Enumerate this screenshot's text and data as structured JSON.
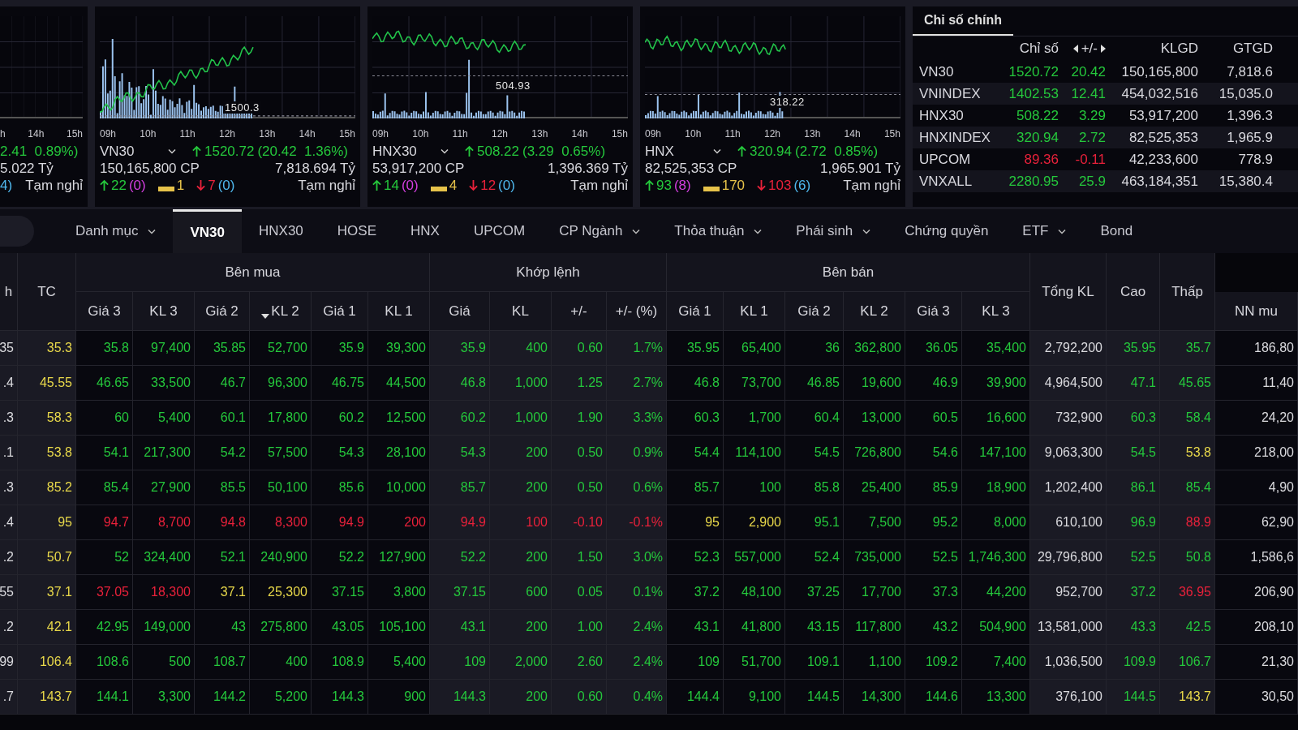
{
  "index_panels": [
    {
      "ticks": [
        "h",
        "14h",
        "15h"
      ],
      "change": "2.41  0.89%)",
      "color": "#25c83c",
      "trading_value": "5.022 Tỷ",
      "floor": "4)",
      "session": "Tạm nghỉ"
    },
    {
      "ticks": [
        "09h",
        "10h",
        "11h",
        "12h",
        "13h",
        "14h",
        "15h"
      ],
      "reference_label": "1500.3",
      "name": "VN30",
      "rising": true,
      "color": "#25c83c",
      "value": "1520.72",
      "change": "(20.42  1.36%)",
      "volume": "150,165,800 CP",
      "trading_value": "7,818.694 Tỷ",
      "up": "22",
      "ceiling": "(0)",
      "ref": "1",
      "down": "7",
      "floor": "(0)",
      "session": "Tạm nghỉ"
    },
    {
      "ticks": [
        "09h",
        "10h",
        "11h",
        "12h",
        "13h",
        "14h",
        "15h"
      ],
      "reference_label": "504.93",
      "name": "HNX30",
      "rising": true,
      "color": "#25c83c",
      "value": "508.22",
      "change": "(3.29  0.65%)",
      "volume": "53,917,200 CP",
      "trading_value": "1,396.369 Tỷ",
      "up": "14",
      "ceiling": "(0)",
      "ref": "4",
      "down": "12",
      "floor": "(0)",
      "session": "Tạm nghỉ"
    },
    {
      "ticks": [
        "09h",
        "10h",
        "11h",
        "12h",
        "13h",
        "14h",
        "15h"
      ],
      "reference_label": "318.22",
      "name": "HNX",
      "rising": true,
      "color": "#25c83c",
      "value": "320.94",
      "change": "(2.72  0.85%)",
      "volume": "82,525,353 CP",
      "trading_value": "1,965.901 Tỷ",
      "up": "93",
      "ceiling": "(8)",
      "ref": "170",
      "down": "103",
      "floor": "(6)",
      "session": "Tạm nghỉ"
    }
  ],
  "main_indices": {
    "tab": {
      "label": "Chỉ số chính",
      "selected": true
    },
    "columns": [
      {
        "label": "Chỉ số",
        "switchable": false
      },
      {
        "label": "+/-",
        "switchable": true
      },
      {
        "label": "KLGD",
        "switchable": false
      },
      {
        "label": "GTGD",
        "switchable": false
      }
    ],
    "rows": [
      {
        "name": "VN30",
        "value": "1520.72",
        "change": "20.42",
        "volume": "150,165,800",
        "trading_value": "7,818.6",
        "color": "#25c83c"
      },
      {
        "name": "VNINDEX",
        "value": "1402.53",
        "change": "12.41",
        "volume": "454,032,516",
        "trading_value": "15,035.0",
        "color": "#25c83c"
      },
      {
        "name": "HNX30",
        "value": "508.22",
        "change": "3.29",
        "volume": "53,917,200",
        "trading_value": "1,396.3",
        "color": "#25c83c"
      },
      {
        "name": "HNXINDEX",
        "value": "320.94",
        "change": "2.72",
        "volume": "82,525,353",
        "trading_value": "1,965.9",
        "color": "#25c83c"
      },
      {
        "name": "UPCOM",
        "value": "89.36",
        "change": "-0.11",
        "volume": "42,233,600",
        "trading_value": "778.9",
        "color": "#e8213a"
      },
      {
        "name": "VNXALL",
        "value": "2280.95",
        "change": "25.9",
        "volume": "463,184,351",
        "trading_value": "15,380.4",
        "color": "#25c83c"
      }
    ]
  },
  "tabs": [
    {
      "label": "Danh mục",
      "dropdown": true,
      "selected": false
    },
    {
      "label": "VN30",
      "dropdown": false,
      "selected": true
    },
    {
      "label": "HNX30",
      "dropdown": false,
      "selected": false
    },
    {
      "label": "HOSE",
      "dropdown": false,
      "selected": false
    },
    {
      "label": "HNX",
      "dropdown": false,
      "selected": false
    },
    {
      "label": "UPCOM",
      "dropdown": false,
      "selected": false
    },
    {
      "label": "CP Ngành",
      "dropdown": true,
      "selected": false
    },
    {
      "label": "Thỏa thuận",
      "dropdown": true,
      "selected": false
    },
    {
      "label": "Phái sinh",
      "dropdown": true,
      "selected": false
    },
    {
      "label": "Chứng quyền",
      "dropdown": false,
      "selected": false
    },
    {
      "label": "ETF",
      "dropdown": true,
      "selected": false
    },
    {
      "label": "Bond",
      "dropdown": false,
      "selected": false
    }
  ],
  "table": {
    "header": [
      {
        "label": "h"
      },
      {
        "label": "TC"
      },
      {
        "label": "Bên mua",
        "columns": [
          {
            "label": "Giá 3",
            "sorted": false
          },
          {
            "label": "KL 3",
            "sorted": false
          },
          {
            "label": "Giá 2",
            "sorted": false
          },
          {
            "label": "KL 2",
            "sorted": true
          },
          {
            "label": "Giá 1",
            "sorted": false
          },
          {
            "label": "KL 1",
            "sorted": false
          }
        ]
      },
      {
        "label": "Khớp lệnh",
        "columns": [
          {
            "label": "Giá",
            "sorted": false
          },
          {
            "label": "KL",
            "sorted": false
          },
          {
            "label": "+/-",
            "sorted": false
          },
          {
            "label": "+/- (%)",
            "sorted": false
          }
        ]
      },
      {
        "label": "Bên bán",
        "columns": [
          {
            "label": "Giá 1",
            "sorted": false
          },
          {
            "label": "KL 1",
            "sorted": false
          },
          {
            "label": "Giá 2",
            "sorted": false
          },
          {
            "label": "KL 2",
            "sorted": false
          },
          {
            "label": "Giá 3",
            "sorted": false
          },
          {
            "label": "KL 3",
            "sorted": false
          }
        ]
      },
      {
        "label": "Tổng KL"
      },
      {
        "label": "Cao"
      },
      {
        "label": "Thấp"
      },
      {
        "columns": [
          {
            "label": "NN mu",
            "sorted": false
          }
        ]
      }
    ],
    "rows": [
      {
        "cells": [
          {
            "text": "35",
            "color": "#dadade"
          },
          {
            "text": "35.3",
            "color": "#e8d84a"
          },
          {
            "text": "35.8",
            "color": "#25c83c"
          },
          {
            "text": "97,400",
            "color": "#25c83c"
          },
          {
            "text": "35.85",
            "color": "#25c83c"
          },
          {
            "text": "52,700",
            "color": "#25c83c"
          },
          {
            "text": "35.9",
            "color": "#25c83c"
          },
          {
            "text": "39,300",
            "color": "#25c83c"
          },
          {
            "text": "35.9",
            "color": "#25c83c"
          },
          {
            "text": "400",
            "color": "#25c83c"
          },
          {
            "text": "0.60",
            "color": "#25c83c"
          },
          {
            "text": "1.7%",
            "color": "#25c83c"
          },
          {
            "text": "35.95",
            "color": "#25c83c"
          },
          {
            "text": "65,400",
            "color": "#25c83c"
          },
          {
            "text": "36",
            "color": "#25c83c"
          },
          {
            "text": "362,800",
            "color": "#25c83c"
          },
          {
            "text": "36.05",
            "color": "#25c83c"
          },
          {
            "text": "35,400",
            "color": "#25c83c"
          },
          {
            "text": "2,792,200",
            "color": "#dadade"
          },
          {
            "text": "35.95",
            "color": "#25c83c"
          },
          {
            "text": "35.7",
            "color": "#25c83c"
          },
          {
            "text": "186,80",
            "color": "#dadade"
          }
        ]
      },
      {
        "cells": [
          {
            "text": ".4",
            "color": "#dadade"
          },
          {
            "text": "45.55",
            "color": "#e8d84a"
          },
          {
            "text": "46.65",
            "color": "#25c83c"
          },
          {
            "text": "33,500",
            "color": "#25c83c"
          },
          {
            "text": "46.7",
            "color": "#25c83c"
          },
          {
            "text": "96,300",
            "color": "#25c83c"
          },
          {
            "text": "46.75",
            "color": "#25c83c"
          },
          {
            "text": "44,500",
            "color": "#25c83c"
          },
          {
            "text": "46.8",
            "color": "#25c83c"
          },
          {
            "text": "1,000",
            "color": "#25c83c"
          },
          {
            "text": "1.25",
            "color": "#25c83c"
          },
          {
            "text": "2.7%",
            "color": "#25c83c"
          },
          {
            "text": "46.8",
            "color": "#25c83c"
          },
          {
            "text": "73,700",
            "color": "#25c83c"
          },
          {
            "text": "46.85",
            "color": "#25c83c"
          },
          {
            "text": "19,600",
            "color": "#25c83c"
          },
          {
            "text": "46.9",
            "color": "#25c83c"
          },
          {
            "text": "39,900",
            "color": "#25c83c"
          },
          {
            "text": "4,964,500",
            "color": "#dadade"
          },
          {
            "text": "47.1",
            "color": "#25c83c"
          },
          {
            "text": "45.65",
            "color": "#25c83c"
          },
          {
            "text": "11,40",
            "color": "#dadade"
          }
        ]
      },
      {
        "cells": [
          {
            "text": ".3",
            "color": "#dadade"
          },
          {
            "text": "58.3",
            "color": "#e8d84a"
          },
          {
            "text": "60",
            "color": "#25c83c"
          },
          {
            "text": "5,400",
            "color": "#25c83c"
          },
          {
            "text": "60.1",
            "color": "#25c83c"
          },
          {
            "text": "17,800",
            "color": "#25c83c"
          },
          {
            "text": "60.2",
            "color": "#25c83c"
          },
          {
            "text": "12,500",
            "color": "#25c83c"
          },
          {
            "text": "60.2",
            "color": "#25c83c"
          },
          {
            "text": "1,000",
            "color": "#25c83c"
          },
          {
            "text": "1.90",
            "color": "#25c83c"
          },
          {
            "text": "3.3%",
            "color": "#25c83c"
          },
          {
            "text": "60.3",
            "color": "#25c83c"
          },
          {
            "text": "1,700",
            "color": "#25c83c"
          },
          {
            "text": "60.4",
            "color": "#25c83c"
          },
          {
            "text": "13,000",
            "color": "#25c83c"
          },
          {
            "text": "60.5",
            "color": "#25c83c"
          },
          {
            "text": "16,600",
            "color": "#25c83c"
          },
          {
            "text": "732,900",
            "color": "#dadade"
          },
          {
            "text": "60.3",
            "color": "#25c83c"
          },
          {
            "text": "58.4",
            "color": "#25c83c"
          },
          {
            "text": "24,20",
            "color": "#dadade"
          }
        ]
      },
      {
        "cells": [
          {
            "text": ".1",
            "color": "#dadade"
          },
          {
            "text": "53.8",
            "color": "#e8d84a"
          },
          {
            "text": "54.1",
            "color": "#25c83c"
          },
          {
            "text": "217,300",
            "color": "#25c83c"
          },
          {
            "text": "54.2",
            "color": "#25c83c"
          },
          {
            "text": "57,500",
            "color": "#25c83c"
          },
          {
            "text": "54.3",
            "color": "#25c83c"
          },
          {
            "text": "28,100",
            "color": "#25c83c"
          },
          {
            "text": "54.3",
            "color": "#25c83c"
          },
          {
            "text": "200",
            "color": "#25c83c"
          },
          {
            "text": "0.50",
            "color": "#25c83c"
          },
          {
            "text": "0.9%",
            "color": "#25c83c"
          },
          {
            "text": "54.4",
            "color": "#25c83c"
          },
          {
            "text": "114,100",
            "color": "#25c83c"
          },
          {
            "text": "54.5",
            "color": "#25c83c"
          },
          {
            "text": "726,800",
            "color": "#25c83c"
          },
          {
            "text": "54.6",
            "color": "#25c83c"
          },
          {
            "text": "147,100",
            "color": "#25c83c"
          },
          {
            "text": "9,063,300",
            "color": "#dadade"
          },
          {
            "text": "54.5",
            "color": "#25c83c"
          },
          {
            "text": "53.8",
            "color": "#e8d84a"
          },
          {
            "text": "218,00",
            "color": "#dadade"
          }
        ]
      },
      {
        "cells": [
          {
            "text": ".3",
            "color": "#dadade"
          },
          {
            "text": "85.2",
            "color": "#e8d84a"
          },
          {
            "text": "85.4",
            "color": "#25c83c"
          },
          {
            "text": "27,900",
            "color": "#25c83c"
          },
          {
            "text": "85.5",
            "color": "#25c83c"
          },
          {
            "text": "50,100",
            "color": "#25c83c"
          },
          {
            "text": "85.6",
            "color": "#25c83c"
          },
          {
            "text": "10,000",
            "color": "#25c83c"
          },
          {
            "text": "85.7",
            "color": "#25c83c"
          },
          {
            "text": "200",
            "color": "#25c83c"
          },
          {
            "text": "0.50",
            "color": "#25c83c"
          },
          {
            "text": "0.6%",
            "color": "#25c83c"
          },
          {
            "text": "85.7",
            "color": "#25c83c"
          },
          {
            "text": "100",
            "color": "#25c83c"
          },
          {
            "text": "85.8",
            "color": "#25c83c"
          },
          {
            "text": "25,400",
            "color": "#25c83c"
          },
          {
            "text": "85.9",
            "color": "#25c83c"
          },
          {
            "text": "18,900",
            "color": "#25c83c"
          },
          {
            "text": "1,202,400",
            "color": "#dadade"
          },
          {
            "text": "86.1",
            "color": "#25c83c"
          },
          {
            "text": "85.4",
            "color": "#25c83c"
          },
          {
            "text": "4,90",
            "color": "#dadade"
          }
        ]
      },
      {
        "cells": [
          {
            "text": ".4",
            "color": "#dadade"
          },
          {
            "text": "95",
            "color": "#e8d84a"
          },
          {
            "text": "94.7",
            "color": "#e8213a"
          },
          {
            "text": "8,700",
            "color": "#e8213a"
          },
          {
            "text": "94.8",
            "color": "#e8213a"
          },
          {
            "text": "8,300",
            "color": "#e8213a"
          },
          {
            "text": "94.9",
            "color": "#e8213a"
          },
          {
            "text": "200",
            "color": "#e8213a"
          },
          {
            "text": "94.9",
            "color": "#e8213a"
          },
          {
            "text": "100",
            "color": "#e8213a"
          },
          {
            "text": "-0.10",
            "color": "#e8213a"
          },
          {
            "text": "-0.1%",
            "color": "#e8213a"
          },
          {
            "text": "95",
            "color": "#e8d84a"
          },
          {
            "text": "2,900",
            "color": "#e8d84a"
          },
          {
            "text": "95.1",
            "color": "#25c83c"
          },
          {
            "text": "7,500",
            "color": "#25c83c"
          },
          {
            "text": "95.2",
            "color": "#25c83c"
          },
          {
            "text": "8,000",
            "color": "#25c83c"
          },
          {
            "text": "610,100",
            "color": "#dadade"
          },
          {
            "text": "96.9",
            "color": "#25c83c"
          },
          {
            "text": "88.9",
            "color": "#e8213a"
          },
          {
            "text": "62,90",
            "color": "#dadade"
          }
        ]
      },
      {
        "cells": [
          {
            "text": ".2",
            "color": "#dadade"
          },
          {
            "text": "50.7",
            "color": "#e8d84a"
          },
          {
            "text": "52",
            "color": "#25c83c"
          },
          {
            "text": "324,400",
            "color": "#25c83c"
          },
          {
            "text": "52.1",
            "color": "#25c83c"
          },
          {
            "text": "240,900",
            "color": "#25c83c"
          },
          {
            "text": "52.2",
            "color": "#25c83c"
          },
          {
            "text": "127,900",
            "color": "#25c83c"
          },
          {
            "text": "52.2",
            "color": "#25c83c"
          },
          {
            "text": "200",
            "color": "#25c83c"
          },
          {
            "text": "1.50",
            "color": "#25c83c"
          },
          {
            "text": "3.0%",
            "color": "#25c83c"
          },
          {
            "text": "52.3",
            "color": "#25c83c"
          },
          {
            "text": "557,000",
            "color": "#25c83c"
          },
          {
            "text": "52.4",
            "color": "#25c83c"
          },
          {
            "text": "735,000",
            "color": "#25c83c"
          },
          {
            "text": "52.5",
            "color": "#25c83c"
          },
          {
            "text": "1,746,300",
            "color": "#25c83c"
          },
          {
            "text": "29,796,800",
            "color": "#dadade"
          },
          {
            "text": "52.5",
            "color": "#25c83c"
          },
          {
            "text": "50.8",
            "color": "#25c83c"
          },
          {
            "text": "1,586,6",
            "color": "#dadade"
          }
        ]
      },
      {
        "cells": [
          {
            "text": "55",
            "color": "#dadade"
          },
          {
            "text": "37.1",
            "color": "#e8d84a"
          },
          {
            "text": "37.05",
            "color": "#e8213a"
          },
          {
            "text": "18,300",
            "color": "#e8213a"
          },
          {
            "text": "37.1",
            "color": "#e8d84a"
          },
          {
            "text": "25,300",
            "color": "#e8d84a"
          },
          {
            "text": "37.15",
            "color": "#25c83c"
          },
          {
            "text": "3,800",
            "color": "#25c83c"
          },
          {
            "text": "37.15",
            "color": "#25c83c"
          },
          {
            "text": "600",
            "color": "#25c83c"
          },
          {
            "text": "0.05",
            "color": "#25c83c"
          },
          {
            "text": "0.1%",
            "color": "#25c83c"
          },
          {
            "text": "37.2",
            "color": "#25c83c"
          },
          {
            "text": "48,100",
            "color": "#25c83c"
          },
          {
            "text": "37.25",
            "color": "#25c83c"
          },
          {
            "text": "17,700",
            "color": "#25c83c"
          },
          {
            "text": "37.3",
            "color": "#25c83c"
          },
          {
            "text": "44,200",
            "color": "#25c83c"
          },
          {
            "text": "952,700",
            "color": "#dadade"
          },
          {
            "text": "37.2",
            "color": "#25c83c"
          },
          {
            "text": "36.95",
            "color": "#e8213a"
          },
          {
            "text": "206,90",
            "color": "#dadade"
          }
        ]
      },
      {
        "cells": [
          {
            "text": ".2",
            "color": "#dadade"
          },
          {
            "text": "42.1",
            "color": "#e8d84a"
          },
          {
            "text": "42.95",
            "color": "#25c83c"
          },
          {
            "text": "149,000",
            "color": "#25c83c"
          },
          {
            "text": "43",
            "color": "#25c83c"
          },
          {
            "text": "275,800",
            "color": "#25c83c"
          },
          {
            "text": "43.05",
            "color": "#25c83c"
          },
          {
            "text": "105,100",
            "color": "#25c83c"
          },
          {
            "text": "43.1",
            "color": "#25c83c"
          },
          {
            "text": "200",
            "color": "#25c83c"
          },
          {
            "text": "1.00",
            "color": "#25c83c"
          },
          {
            "text": "2.4%",
            "color": "#25c83c"
          },
          {
            "text": "43.1",
            "color": "#25c83c"
          },
          {
            "text": "41,800",
            "color": "#25c83c"
          },
          {
            "text": "43.15",
            "color": "#25c83c"
          },
          {
            "text": "117,800",
            "color": "#25c83c"
          },
          {
            "text": "43.2",
            "color": "#25c83c"
          },
          {
            "text": "504,900",
            "color": "#25c83c"
          },
          {
            "text": "13,581,000",
            "color": "#dadade"
          },
          {
            "text": "43.3",
            "color": "#25c83c"
          },
          {
            "text": "42.5",
            "color": "#25c83c"
          },
          {
            "text": "208,10",
            "color": "#dadade"
          }
        ]
      },
      {
        "cells": [
          {
            "text": "99",
            "color": "#dadade"
          },
          {
            "text": "106.4",
            "color": "#e8d84a"
          },
          {
            "text": "108.6",
            "color": "#25c83c"
          },
          {
            "text": "500",
            "color": "#25c83c"
          },
          {
            "text": "108.7",
            "color": "#25c83c"
          },
          {
            "text": "400",
            "color": "#25c83c"
          },
          {
            "text": "108.9",
            "color": "#25c83c"
          },
          {
            "text": "5,400",
            "color": "#25c83c"
          },
          {
            "text": "109",
            "color": "#25c83c"
          },
          {
            "text": "2,000",
            "color": "#25c83c"
          },
          {
            "text": "2.60",
            "color": "#25c83c"
          },
          {
            "text": "2.4%",
            "color": "#25c83c"
          },
          {
            "text": "109",
            "color": "#25c83c"
          },
          {
            "text": "51,700",
            "color": "#25c83c"
          },
          {
            "text": "109.1",
            "color": "#25c83c"
          },
          {
            "text": "1,100",
            "color": "#25c83c"
          },
          {
            "text": "109.2",
            "color": "#25c83c"
          },
          {
            "text": "7,400",
            "color": "#25c83c"
          },
          {
            "text": "1,036,500",
            "color": "#dadade"
          },
          {
            "text": "109.9",
            "color": "#25c83c"
          },
          {
            "text": "106.7",
            "color": "#25c83c"
          },
          {
            "text": "21,30",
            "color": "#dadade"
          }
        ]
      },
      {
        "cells": [
          {
            "text": ".7",
            "color": "#dadade"
          },
          {
            "text": "143.7",
            "color": "#e8d84a"
          },
          {
            "text": "144.1",
            "color": "#25c83c"
          },
          {
            "text": "3,300",
            "color": "#25c83c"
          },
          {
            "text": "144.2",
            "color": "#25c83c"
          },
          {
            "text": "5,200",
            "color": "#25c83c"
          },
          {
            "text": "144.3",
            "color": "#25c83c"
          },
          {
            "text": "900",
            "color": "#25c83c"
          },
          {
            "text": "144.3",
            "color": "#25c83c"
          },
          {
            "text": "200",
            "color": "#25c83c"
          },
          {
            "text": "0.60",
            "color": "#25c83c"
          },
          {
            "text": "0.4%",
            "color": "#25c83c"
          },
          {
            "text": "144.4",
            "color": "#25c83c"
          },
          {
            "text": "9,100",
            "color": "#25c83c"
          },
          {
            "text": "144.5",
            "color": "#25c83c"
          },
          {
            "text": "14,300",
            "color": "#25c83c"
          },
          {
            "text": "144.6",
            "color": "#25c83c"
          },
          {
            "text": "13,300",
            "color": "#25c83c"
          },
          {
            "text": "376,100",
            "color": "#dadade"
          },
          {
            "text": "144.5",
            "color": "#25c83c"
          },
          {
            "text": "143.7",
            "color": "#e8d84a"
          },
          {
            "text": "30,50",
            "color": "#dadade"
          }
        ]
      }
    ]
  }
}
